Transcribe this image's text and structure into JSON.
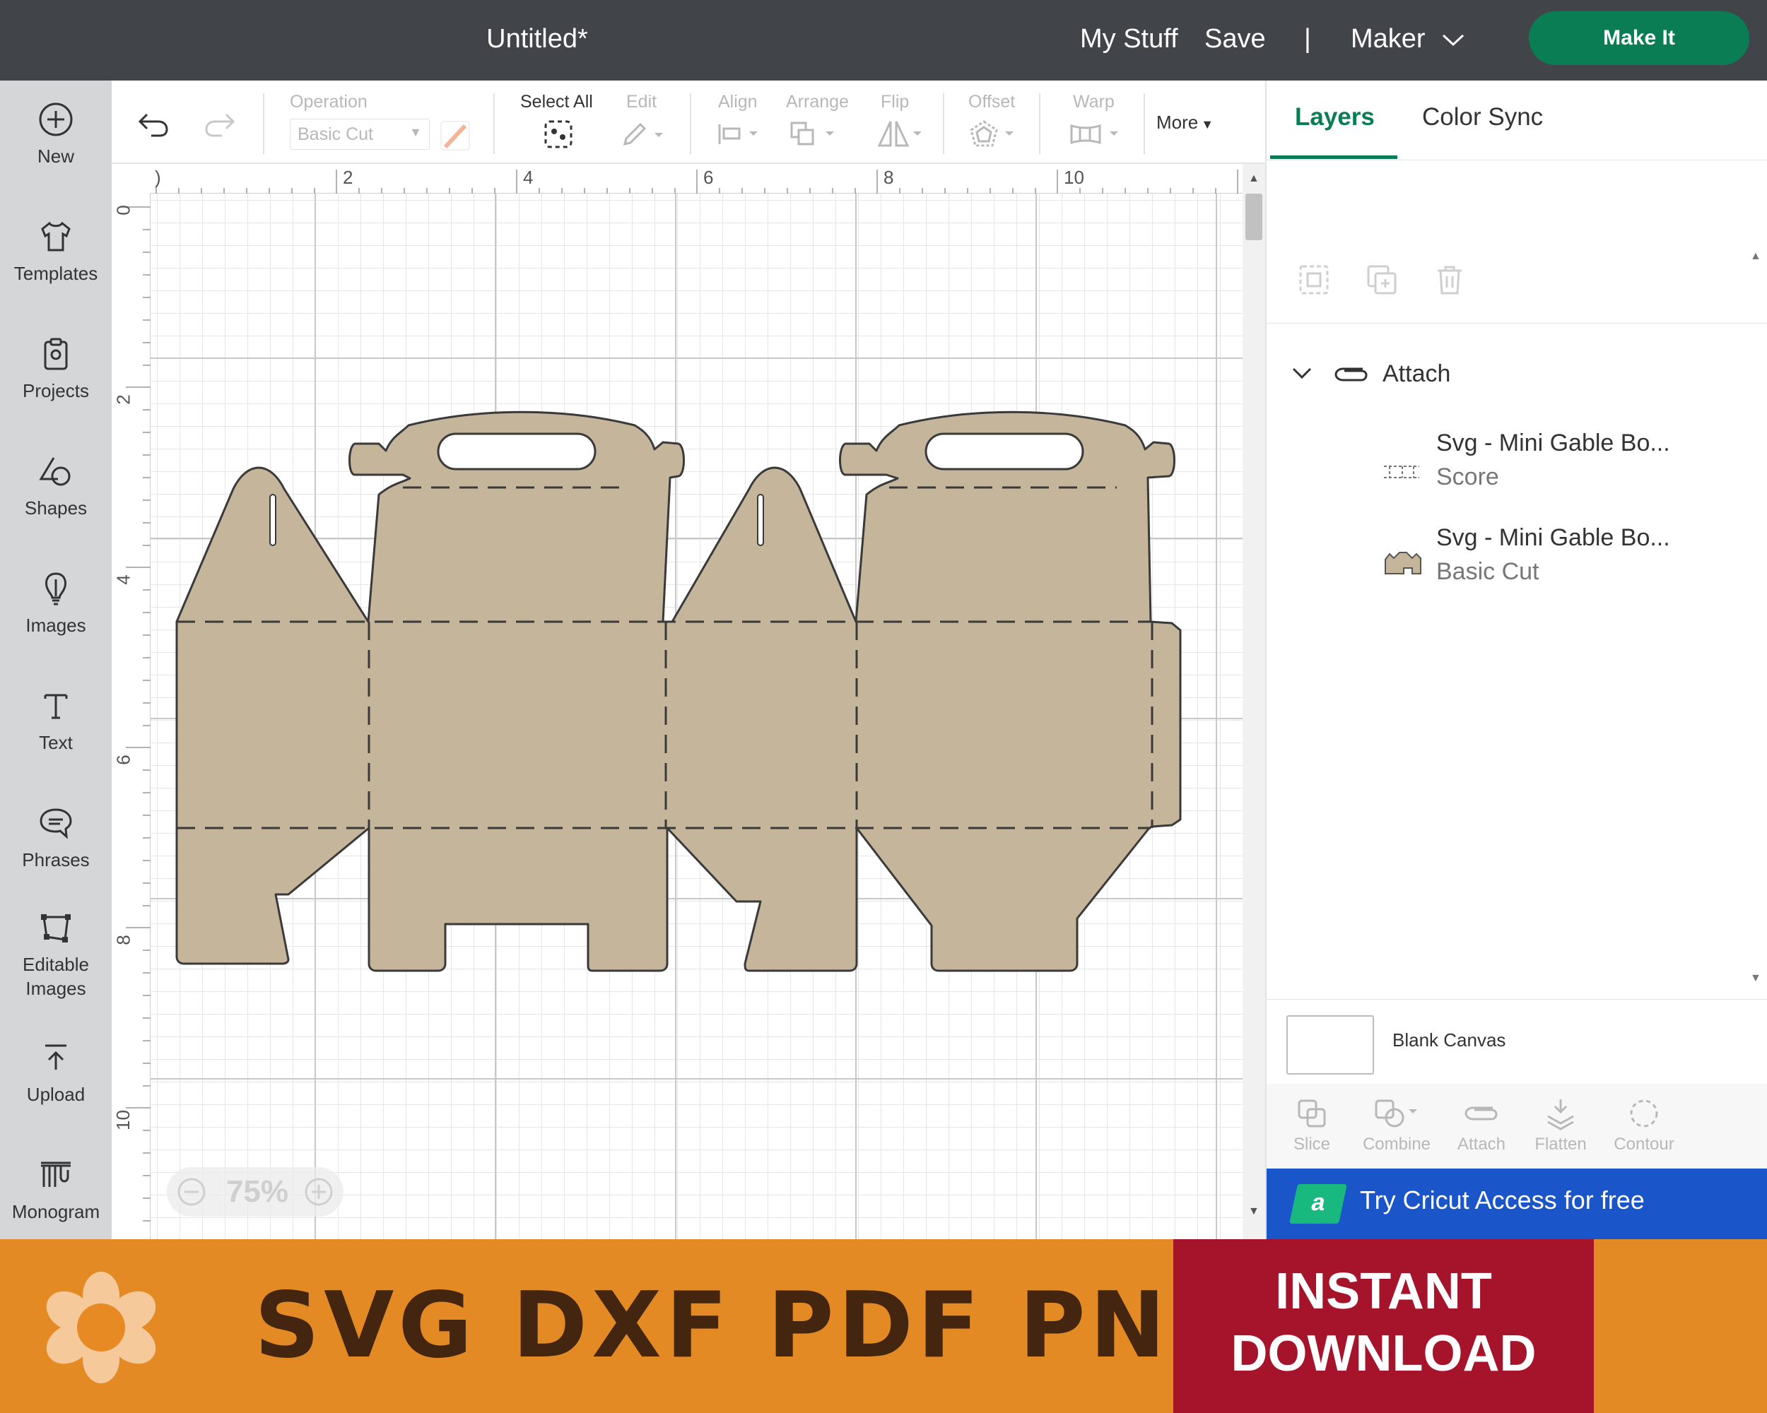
{
  "header": {
    "title": "Untitled*",
    "my_stuff": "My Stuff",
    "save": "Save",
    "separator": "|",
    "machine": "Maker",
    "make_it": "Make It"
  },
  "sidebar": {
    "items": [
      {
        "label": "New",
        "icon": "plus-circle-icon"
      },
      {
        "label": "Templates",
        "icon": "shirt-icon"
      },
      {
        "label": "Projects",
        "icon": "clipboard-icon"
      },
      {
        "label": "Shapes",
        "icon": "shapes-icon"
      },
      {
        "label": "Images",
        "icon": "bulb-icon"
      },
      {
        "label": "Text",
        "icon": "text-icon"
      },
      {
        "label": "Phrases",
        "icon": "speech-bubble-icon"
      },
      {
        "label": "Editable Images",
        "icon": "vector-edit-icon"
      },
      {
        "label": "Upload",
        "icon": "upload-arrow-icon"
      },
      {
        "label": "Monogram",
        "icon": "monogram-icon"
      }
    ]
  },
  "toolbar": {
    "operation_label": "Operation",
    "operation_value": "Basic Cut",
    "select_all": "Select All",
    "edit": "Edit",
    "align": "Align",
    "arrange": "Arrange",
    "flip": "Flip",
    "offset": "Offset",
    "warp": "Warp",
    "more": "More"
  },
  "canvas": {
    "ruler_top": [
      "2",
      "4",
      "6",
      "8",
      "10"
    ],
    "ruler_left": [
      "0",
      "2",
      "4",
      "6",
      "8",
      "10"
    ],
    "zoom": "75%",
    "design_color": "#c4b59b"
  },
  "panel": {
    "tabs": [
      "Layers",
      "Color Sync"
    ],
    "group_name": "Attach",
    "layers": [
      {
        "name": "Svg - Mini Gable Bo...",
        "type": "Score"
      },
      {
        "name": "Svg - Mini Gable Bo...",
        "type": "Basic Cut"
      }
    ],
    "blank_canvas": "Blank Canvas",
    "tools": [
      "Slice",
      "Combine",
      "Attach",
      "Flatten",
      "Contour"
    ],
    "promo": "Try Cricut Access for free",
    "promo_badge": "a"
  },
  "banner": {
    "formats": "SVG DXF PDF PNG",
    "cta_line1": "INSTANT",
    "cta_line2": "DOWNLOAD"
  },
  "colors": {
    "topbar": "#41454a",
    "accent_green": "#0b7d54",
    "banner_orange": "#e38a24",
    "banner_red": "#a5142b",
    "promo_blue": "#1a56c9"
  }
}
